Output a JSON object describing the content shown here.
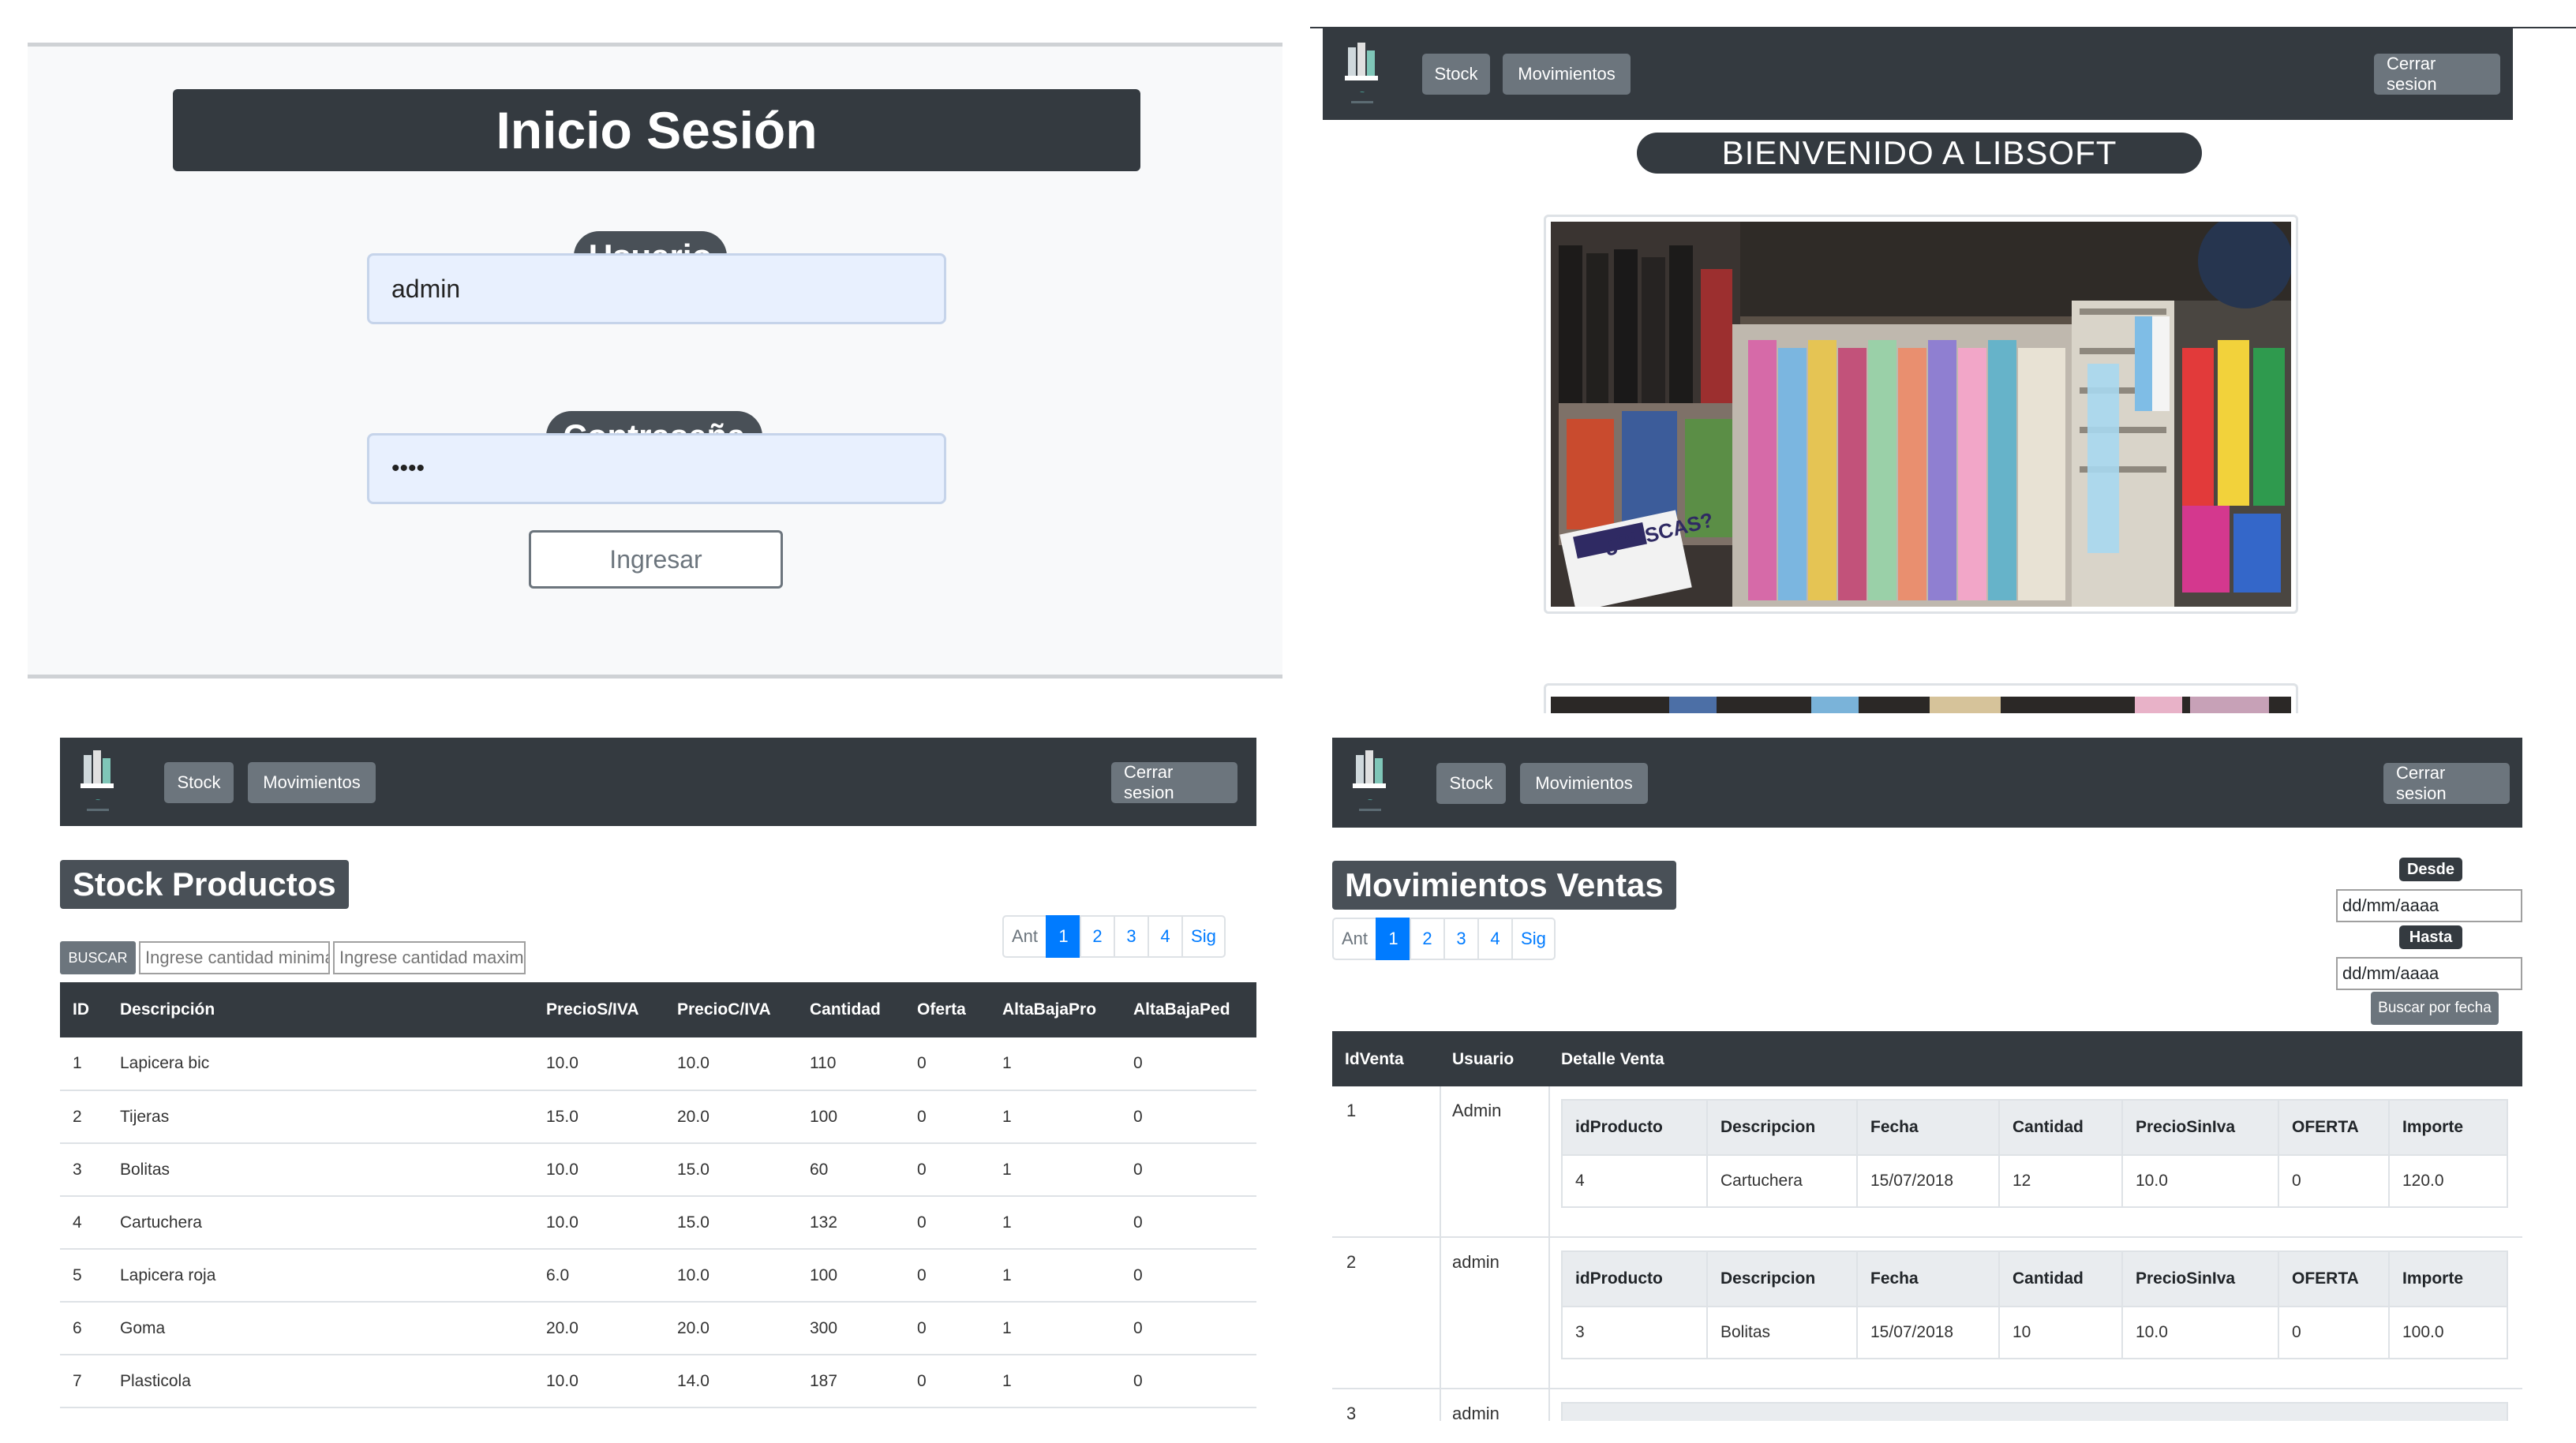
{
  "login": {
    "title": "Inicio Sesión",
    "user_label": "Usuario",
    "user_value": "admin",
    "password_label": "Contraseña",
    "password_value": "••••",
    "submit_label": "Ingresar"
  },
  "nav": {
    "stock": "Stock",
    "movimientos": "Movimientos",
    "logout": "Cerrar sesion"
  },
  "welcome": {
    "banner": "BIENVENIDO A LIBSOFT",
    "photo_sign": "¿BUSCAS?"
  },
  "stock": {
    "title": "Stock Productos",
    "search_button": "BUSCAR",
    "min_placeholder": "Ingrese cantidad minima",
    "max_placeholder": "Ingrese cantidad maxima",
    "pagination": [
      "Ant",
      "1",
      "2",
      "3",
      "4",
      "Sig"
    ],
    "columns": [
      "ID",
      "Descripción",
      "PrecioS/IVA",
      "PrecioC/IVA",
      "Cantidad",
      "Oferta",
      "AltaBajaPro",
      "AltaBajaPed"
    ],
    "rows": [
      [
        "1",
        "Lapicera bic",
        "10.0",
        "10.0",
        "110",
        "0",
        "1",
        "0"
      ],
      [
        "2",
        "Tijeras",
        "15.0",
        "20.0",
        "100",
        "0",
        "1",
        "0"
      ],
      [
        "3",
        "Bolitas",
        "10.0",
        "15.0",
        "60",
        "0",
        "1",
        "0"
      ],
      [
        "4",
        "Cartuchera",
        "10.0",
        "15.0",
        "132",
        "0",
        "1",
        "0"
      ],
      [
        "5",
        "Lapicera roja",
        "6.0",
        "10.0",
        "100",
        "0",
        "1",
        "0"
      ],
      [
        "6",
        "Goma",
        "20.0",
        "20.0",
        "300",
        "0",
        "1",
        "0"
      ],
      [
        "7",
        "Plasticola",
        "10.0",
        "14.0",
        "187",
        "0",
        "1",
        "0"
      ]
    ]
  },
  "movs": {
    "title": "Movimientos Ventas",
    "pagination": [
      "Ant",
      "1",
      "2",
      "3",
      "4",
      "Sig"
    ],
    "desde_label": "Desde",
    "hasta_label": "Hasta",
    "desde_value": "dd/mm/aaaa",
    "hasta_value": "dd/mm/aaaa",
    "date_button": "Buscar por fecha",
    "columns": [
      "IdVenta",
      "Usuario",
      "Detalle Venta"
    ],
    "detail_columns": [
      "idProducto",
      "Descripcion",
      "Fecha",
      "Cantidad",
      "PrecioSinIva",
      "OFERTA",
      "Importe"
    ],
    "sales": [
      {
        "id": "1",
        "user": "Admin",
        "detail": [
          "4",
          "Cartuchera",
          "15/07/2018",
          "12",
          "10.0",
          "0",
          "120.0"
        ]
      },
      {
        "id": "2",
        "user": "admin",
        "detail": [
          "3",
          "Bolitas",
          "15/07/2018",
          "10",
          "10.0",
          "0",
          "100.0"
        ]
      },
      {
        "id": "3",
        "user": "admin",
        "detail": []
      }
    ]
  },
  "colors": {
    "dark": "#343a40",
    "secondary": "#6c757d",
    "primary": "#007bff",
    "input_fill": "#e8f0fe"
  }
}
